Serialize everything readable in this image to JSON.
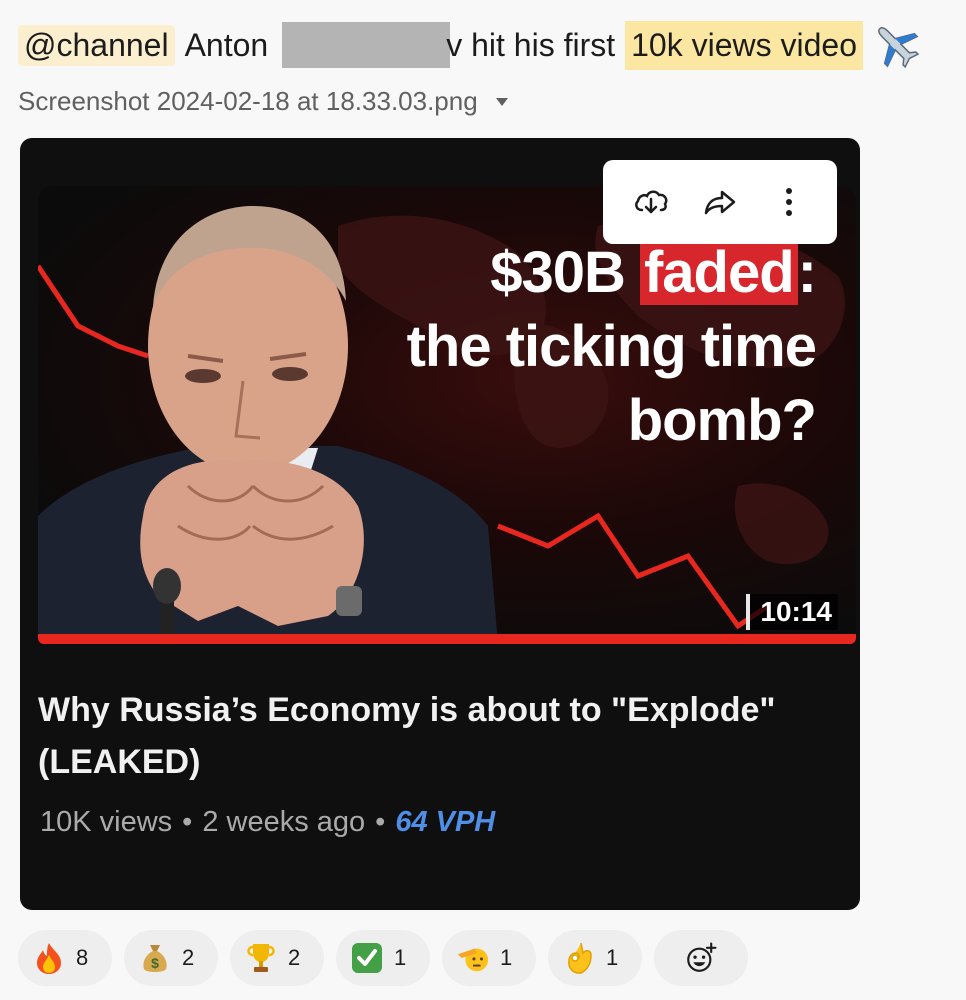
{
  "message": {
    "mention": "@channel",
    "text_before": "Anton",
    "text_after": "v hit his first",
    "highlight": "10k views video",
    "trailing_emoji": "airplane-emoji"
  },
  "attachment": {
    "filename": "Screenshot 2024-02-18 at 18.33.03.png"
  },
  "video": {
    "headline_part1": "$30B ",
    "headline_red": "faded",
    "headline_part2": ":",
    "headline_line2": "the ticking time",
    "headline_line3": "bomb?",
    "duration": "10:14",
    "title": "Why Russia’s Economy is about to \"Explode\" (LEAKED)",
    "views": "10K views",
    "age": "2 weeks ago",
    "vph": "64 VPH",
    "separator": "•",
    "progress_watched": 1.0
  },
  "toolbar": {
    "icons": [
      "download-icon",
      "share-icon",
      "more-options-icon"
    ]
  },
  "reactions": [
    {
      "emoji": "fire",
      "count": "8"
    },
    {
      "emoji": "money-bag",
      "count": "2"
    },
    {
      "emoji": "trophy",
      "count": "2"
    },
    {
      "emoji": "check-mark",
      "count": "1"
    },
    {
      "emoji": "saluting-face",
      "count": "1"
    },
    {
      "emoji": "ok-hand",
      "count": "1"
    }
  ],
  "colors": {
    "mention_bg": "#fcefd0",
    "highlight_bg": "#fbe6a2",
    "progress_red": "#e8271f",
    "vph_blue": "#4f8fe8"
  }
}
